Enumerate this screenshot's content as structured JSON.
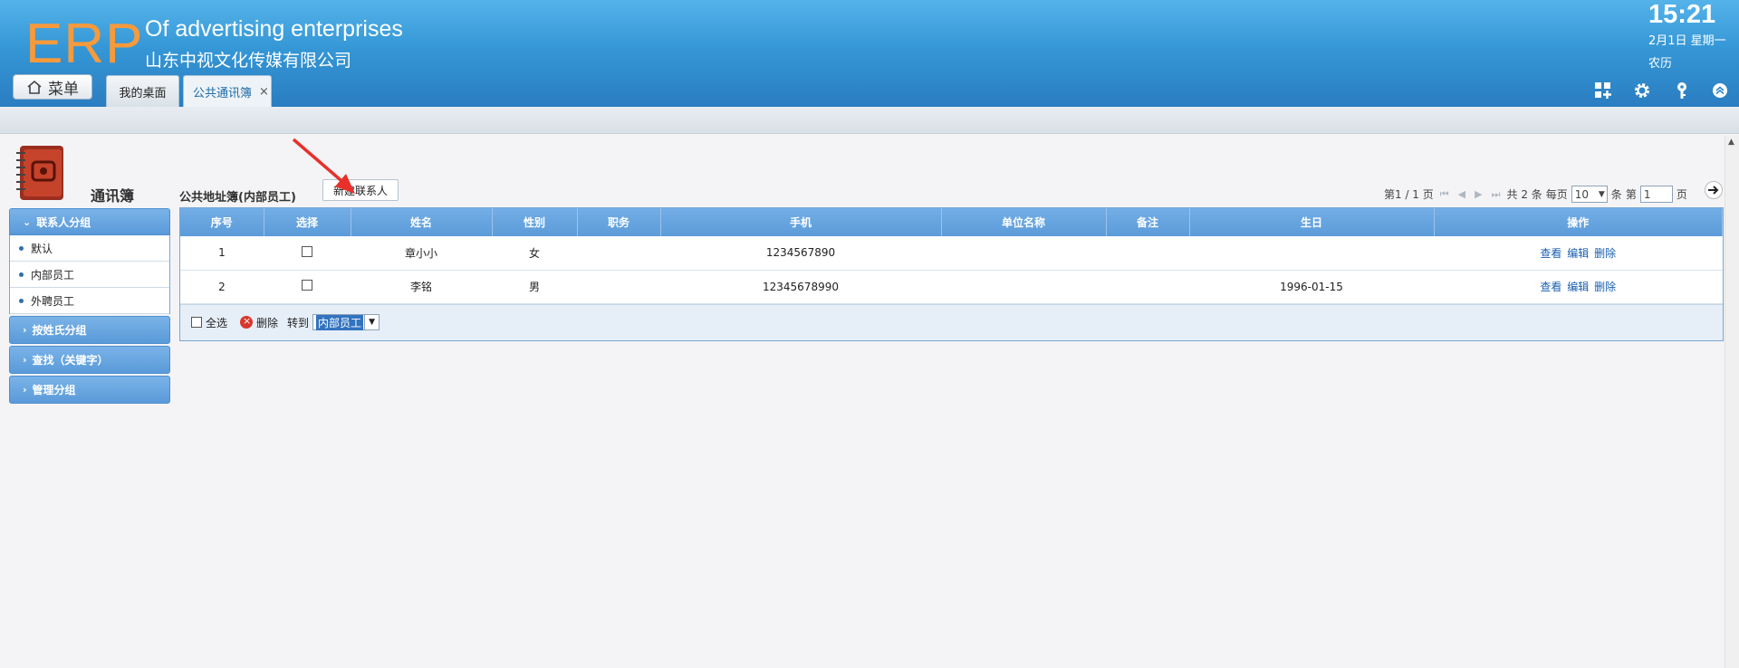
{
  "header": {
    "logo": "ERP",
    "company_en": "Of advertising enterprises",
    "company_cn": "山东中视文化传媒有限公司",
    "clock": "15:21",
    "date": "2月1日 星期一",
    "lunar": "农历",
    "menu_label": "菜单",
    "icons": [
      "grid-add-icon",
      "gear-icon",
      "key-icon",
      "collapse-up-icon"
    ]
  },
  "tabs": [
    {
      "label": "我的桌面",
      "active": false
    },
    {
      "label": "公共通讯簿",
      "active": true,
      "close": "×"
    }
  ],
  "left": {
    "book_title": "通讯簿",
    "groups_head": "联系人分组",
    "groups": [
      "默认",
      "内部员工",
      "外聘员工"
    ],
    "sections": [
      "按姓氏分组",
      "查找（关键字）",
      "管理分组"
    ]
  },
  "main": {
    "addr_title": "公共地址簿(内部员工)",
    "new_contact": "新建联系人",
    "pager": {
      "page_info": "第1 / 1 页",
      "total": "共 2 条",
      "per_page_label": "每页",
      "per_page": "10",
      "unit": "条",
      "goto_label": "第",
      "page_value": "1",
      "page_suffix": "页"
    },
    "columns": [
      "序号",
      "选择",
      "姓名",
      "性别",
      "职务",
      "手机",
      "单位名称",
      "备注",
      "生日",
      "操作"
    ],
    "rows": [
      {
        "no": "1",
        "name": "章小小",
        "gender": "女",
        "title": "",
        "mobile": "1234567890",
        "company": "",
        "remark": "",
        "birthday": ""
      },
      {
        "no": "2",
        "name": "李铭",
        "gender": "男",
        "title": "",
        "mobile": "12345678990",
        "company": "",
        "remark": "",
        "birthday": "1996-01-15"
      }
    ],
    "ops": {
      "view": "查看",
      "edit": "编辑",
      "delete": "删除"
    },
    "footer": {
      "select_all": "全选",
      "delete": "删除",
      "move_to": "转到",
      "move_target": "内部员工"
    }
  },
  "colors": {
    "header_top": "#55b3ea",
    "header_bottom": "#2a7dc0",
    "logo": "#f79a3c",
    "grid_head": "#5b9bd9",
    "link": "#1a5fb0",
    "annotation_arrow": "#e8302a"
  }
}
